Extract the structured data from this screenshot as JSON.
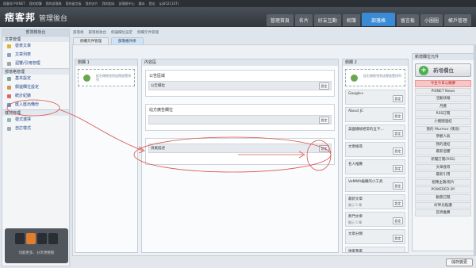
{
  "topbar": [
    "痞客邦 PIXNET",
    "我的相簿",
    "我的部落格",
    "我的留言板",
    "我的名片",
    "我的相本",
    "部落格中心",
    "鐵本",
    "登出",
    "(pj0521107)"
  ],
  "header": {
    "logo": "痞客邦",
    "subtitle": "管理後台",
    "nav": [
      "管理首頁",
      "名片",
      "好友互動",
      "相簿",
      "部落格",
      "留言板",
      "小圈圈",
      "帳戶管理"
    ],
    "active_nav": "部落格"
  },
  "sidebar": {
    "title": "部落格後台",
    "sections": [
      {
        "title": "文章管理",
        "items": [
          {
            "label": "發表文章",
            "color": "#e0b32a"
          },
          {
            "label": "文章列表",
            "color": "#8aa4c0"
          },
          {
            "label": "迴響/引用管理",
            "color": "#9aa"
          }
        ]
      },
      {
        "title": "部落格管理",
        "items": [
          {
            "label": "基本設定",
            "color": "#7a9"
          },
          {
            "label": "側邊欄位設定",
            "color": "#c95"
          },
          {
            "label": "統計紀錄",
            "color": "#d66"
          },
          {
            "label": "匯入匯出備份",
            "color": "#69c"
          }
        ]
      },
      {
        "title": "樣式管理",
        "items": [
          {
            "label": "樣式選擇",
            "color": "#8bb"
          },
          {
            "label": "自訂樣式",
            "color": "#9ab"
          }
        ]
      }
    ],
    "promo": "功能更多、分享更輕鬆"
  },
  "breadcrumb": [
    "部落格",
    "部落格後台",
    "側邊欄位設定",
    "側欄元件管理"
  ],
  "subtabs": [
    "側欄元件管理",
    "部落格外掛"
  ],
  "active_subtab": "部落格外掛",
  "columns": {
    "side1": {
      "title": "側欄 1",
      "drop": "從右側拖曳到這裡放置排列"
    },
    "content": {
      "title": "內容區",
      "boxes": [
        {
          "title": "公告區域",
          "bar": "公告欄位"
        },
        {
          "title": "站方廣告欄位",
          "bar": ""
        },
        {
          "title": "",
          "bar": "頁尾描述"
        }
      ]
    },
    "side2": {
      "title": "側欄 2",
      "drop": "從右側拖曳到這裡放置排列",
      "widgets": [
        {
          "label": "Google+",
          "sub": ""
        },
        {
          "label": "About JC",
          "sub": ""
        },
        {
          "label": "美國總統經常的五千...",
          "sub": ""
        },
        {
          "label": "文章搜尋",
          "sub": ""
        },
        {
          "label": "名人推薦",
          "sub": ""
        },
        {
          "label": "VeMMA編輯的小工具",
          "sub": ""
        },
        {
          "label": "最新文章",
          "sub": "顯示 5 筆"
        },
        {
          "label": "熱門文章",
          "sub": "顯示 5 筆"
        },
        {
          "label": "文章分類",
          "sub": ""
        },
        {
          "label": "誰來我家",
          "sub": "顯示 10 筆"
        }
      ]
    }
  },
  "set_label": "設定",
  "palette": {
    "title": "新增欄位元件",
    "new_button": "新增欄位",
    "items": [
      "今生今日心願夢",
      "PIXNET News",
      "活動快報",
      "月曆",
      "RSS訂閱",
      "小圈圈連結",
      "我的 Murmur (噗浪)",
      "參觀人氣",
      "我的連結",
      "最新迴響",
      "新聞訂閱(RSS)",
      "文章搜尋",
      "最新引用",
      "相簿主題/照片",
      "POWERED BY",
      "動態訂閱",
      "好神光點讚",
      "首頁推薦"
    ]
  },
  "save_label": "儲存變更",
  "colors": {
    "accent": "#3b8ad6",
    "annotation": "#d9534f"
  }
}
